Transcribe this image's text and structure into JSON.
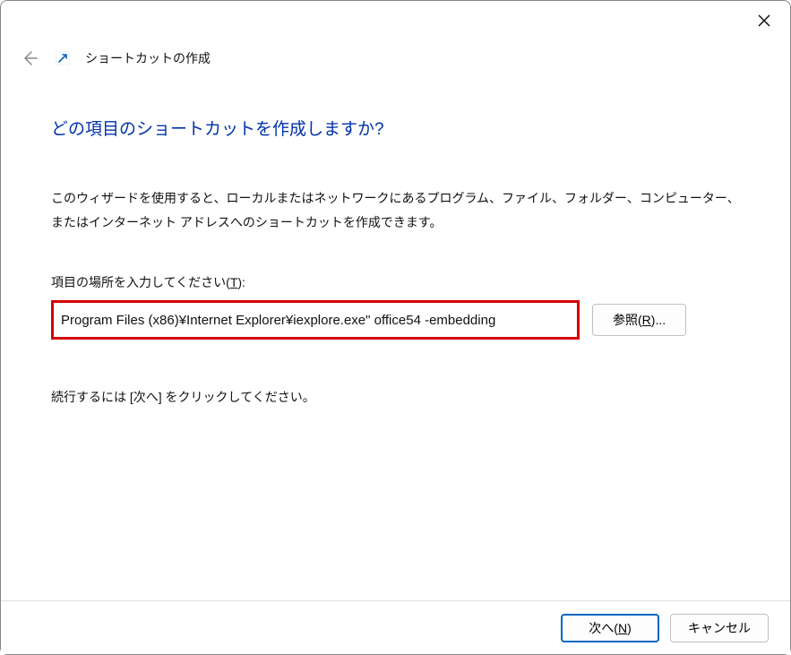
{
  "window": {
    "title": "ショートカットの作成"
  },
  "heading": "どの項目のショートカットを作成しますか?",
  "description": "このウィザードを使用すると、ローカルまたはネットワークにあるプログラム、ファイル、フォルダー、コンピューター、またはインターネット アドレスへのショートカットを作成できます。",
  "input": {
    "label_prefix": "項目の場所を入力してください(",
    "label_accel": "T",
    "label_suffix": "):",
    "value": "Program Files (x86)¥Internet Explorer¥iexplore.exe\" office54 -embedding"
  },
  "buttons": {
    "browse_prefix": "参照(",
    "browse_accel": "R",
    "browse_suffix": ")...",
    "next_prefix": "次へ(",
    "next_accel": "N",
    "next_suffix": ")",
    "cancel": "キャンセル"
  },
  "continue_text": "続行するには [次へ] をクリックしてください。"
}
